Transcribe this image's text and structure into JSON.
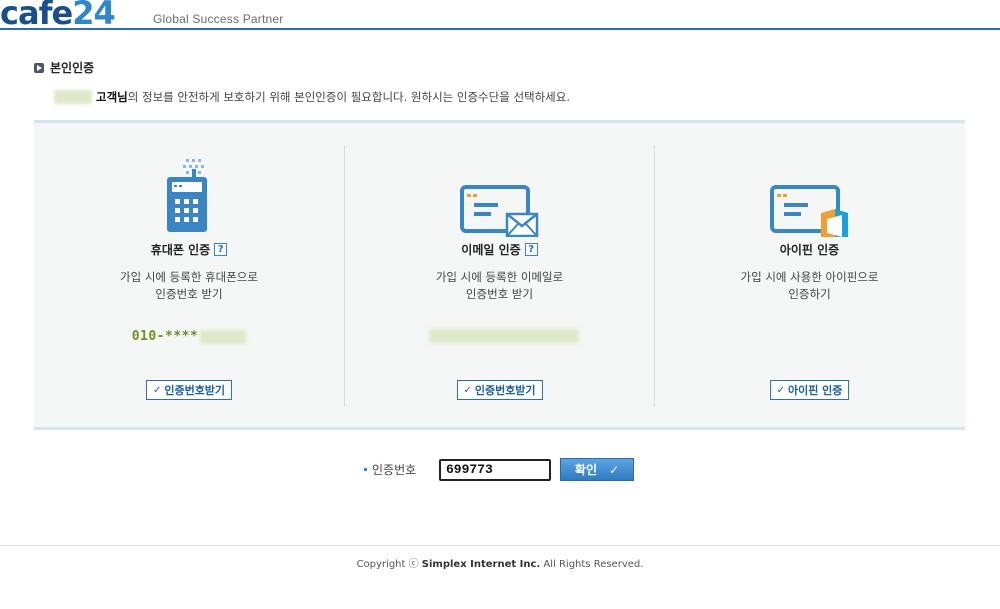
{
  "header": {
    "logo_text": "cafe",
    "logo_num": "24",
    "tagline": "Global Success Partner"
  },
  "section": {
    "title": "본인인증",
    "customer_suffix": "고객님",
    "description": "의 정보를 안전하게 보호하기 위해 본인인증이 필요합니다. 원하시는 인증수단을 선택하세요."
  },
  "methods": [
    {
      "title": "휴대폰 인증",
      "help": "?",
      "description": "가입 시에 등록한 휴대폰으로\n인증번호 받기",
      "masked_value": "010-****",
      "button_label": "인증번호받기",
      "icon": "phone-icon"
    },
    {
      "title": "이메일 인증",
      "help": "?",
      "description": "가입 시에 등록한 이메일로\n인증번호 받기",
      "button_label": "인증번호받기",
      "icon": "email-icon"
    },
    {
      "title": "아이핀 인증",
      "description": "가입 시에 사용한 아이핀으로\n인증하기",
      "button_label": "아이핀 인증",
      "icon": "ipin-icon"
    }
  ],
  "verify": {
    "label": "인증번호",
    "value": "699773",
    "confirm_label": "확인"
  },
  "footer": {
    "prefix": "Copyright ⓒ ",
    "company": "Simplex Internet Inc.",
    "suffix": " All Rights Reserved."
  },
  "colors": {
    "brand_dark": "#1b4f8a",
    "brand_light": "#2f86c9",
    "accent_green": "#6f8f1f",
    "panel_border": "#d3e5f3"
  }
}
